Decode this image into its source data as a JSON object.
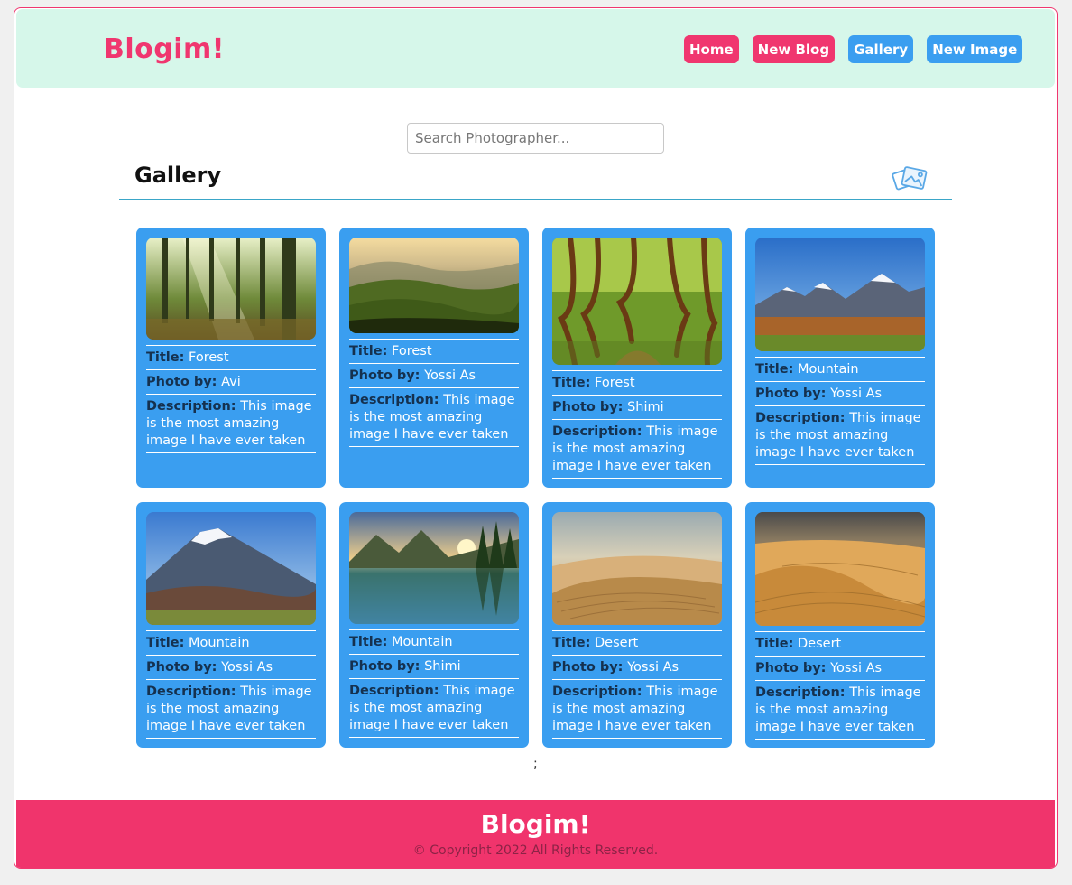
{
  "header": {
    "brand": "Blogim!",
    "nav": [
      {
        "label": "Home",
        "color": "#f0366f"
      },
      {
        "label": "New Blog",
        "color": "#f0366f"
      },
      {
        "label": "Gallery",
        "color": "#3a9ef0"
      },
      {
        "label": "New Image",
        "color": "#3a9ef0"
      }
    ]
  },
  "search": {
    "placeholder": "Search Photographer...",
    "value": ""
  },
  "gallery": {
    "title": "Gallery",
    "icon": "images-icon",
    "labels": {
      "title": "Title:",
      "photo_by": "Photo by:",
      "description": "Description:"
    },
    "cards": [
      {
        "title": "Forest",
        "photo_by": "Avi",
        "description": "This image is the most amazing image I have ever taken",
        "image": "forest-sunbeams"
      },
      {
        "title": "Forest",
        "photo_by": "Yossi As",
        "description": "This image is the most amazing image I have ever taken",
        "image": "green-hills"
      },
      {
        "title": "Forest",
        "photo_by": "Shimi",
        "description": "This image is the most amazing image I have ever taken",
        "image": "crooked-forest"
      },
      {
        "title": "Mountain",
        "photo_by": "Yossi As",
        "description": "This image is the most amazing image I have ever taken",
        "image": "snowy-peaks"
      },
      {
        "title": "Mountain",
        "photo_by": "Yossi As",
        "description": "This image is the most amazing image I have ever taken",
        "image": "volcano"
      },
      {
        "title": "Mountain",
        "photo_by": "Shimi",
        "description": "This image is the most amazing image I have ever taken",
        "image": "lake-reflection"
      },
      {
        "title": "Desert",
        "photo_by": "Yossi As",
        "description": "This image is the most amazing image I have ever taken",
        "image": "dunes-pale"
      },
      {
        "title": "Desert",
        "photo_by": "Yossi As",
        "description": "This image is the most amazing image I have ever taken",
        "image": "dunes-golden"
      }
    ]
  },
  "stray_text": ";",
  "footer": {
    "brand": "Blogim!",
    "copyright": "© Copyright 2022 All Rights Reserved."
  },
  "colors": {
    "accent_pink": "#f0366f",
    "accent_blue": "#3a9ef0",
    "header_bg": "#d6f7ea"
  }
}
